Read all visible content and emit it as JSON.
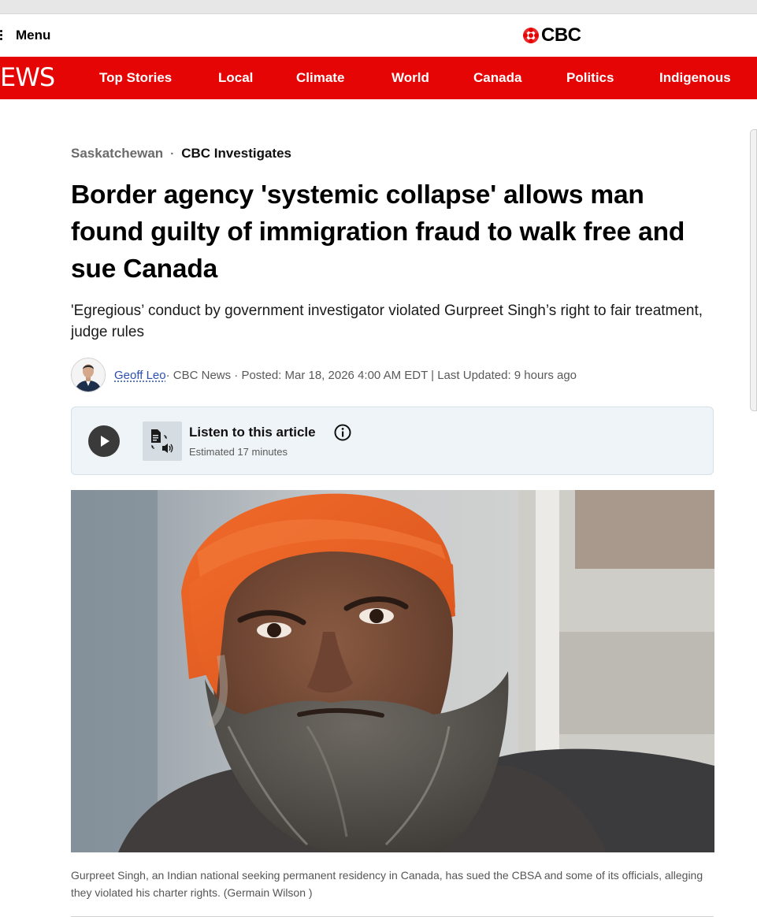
{
  "header": {
    "menu_label": "Menu",
    "logo_text": "CBC"
  },
  "nav": {
    "brand": "EWS",
    "items": [
      {
        "label": "Top Stories"
      },
      {
        "label": "Local"
      },
      {
        "label": "Climate"
      },
      {
        "label": "World"
      },
      {
        "label": "Canada"
      },
      {
        "label": "Politics"
      },
      {
        "label": "Indigenous"
      }
    ]
  },
  "article": {
    "breadcrumb": {
      "section": "Saskatchewan",
      "separator": "·",
      "series": "CBC Investigates"
    },
    "headline": "Border agency 'systemic collapse' allows man found guilty of immigration fraud to walk free and sue Canada",
    "deck": "'Egregious’ conduct by government investigator violated Gurpreet Singh’s right to fair treatment, judge rules",
    "byline": {
      "author": "Geoff Leo",
      "meta": " · CBC News · Posted: Mar 18, 2026 4:00 AM EDT | Last Updated: 9 hours ago"
    },
    "listen": {
      "title": "Listen to this article",
      "subtitle": "Estimated 17 minutes"
    },
    "image": {
      "caption": "Gurpreet Singh, an Indian national seeking permanent residency in Canada, has sued the CBSA and some of its officials, alleging they violated his charter rights. (Germain Wilson )"
    }
  },
  "colors": {
    "brand_red": "#e60505",
    "listen_bg": "#eef4f7",
    "link_blue": "#2a4fb0"
  },
  "icons": [
    "menu-icon",
    "cbc-gem-icon",
    "play-icon",
    "document-audio-icon",
    "info-icon"
  ]
}
